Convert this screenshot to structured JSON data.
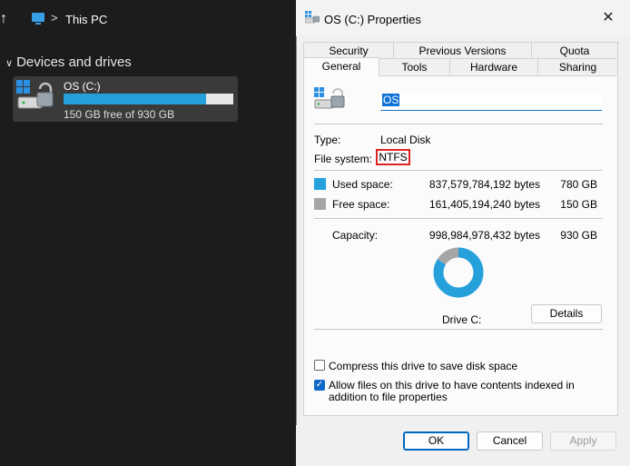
{
  "explorer": {
    "up_arrow": "↑",
    "chevron": ">",
    "location": "This PC",
    "section_caret": "∨",
    "section_title": "Devices and drives",
    "drive": {
      "name": "OS (C:)",
      "free_text": "150 GB free of 930 GB",
      "used_fraction": 0.84
    }
  },
  "dialog": {
    "title": "OS (C:) Properties",
    "close": "✕",
    "tabs_top": [
      "Security",
      "Previous Versions",
      "Quota"
    ],
    "tabs_bottom": [
      "General",
      "Tools",
      "Hardware",
      "Sharing"
    ],
    "active_tab": "General",
    "volume_name": "OS",
    "type_label": "Type:",
    "type_value": "Local Disk",
    "fs_label": "File system:",
    "fs_value": "NTFS",
    "used_label": "Used space:",
    "used_bytes": "837,579,784,192 bytes",
    "used_size": "780 GB",
    "free_label": "Free space:",
    "free_bytes": "161,405,194,240 bytes",
    "free_size": "150 GB",
    "capacity_label": "Capacity:",
    "capacity_bytes": "998,984,978,432 bytes",
    "capacity_size": "930 GB",
    "drive_label": "Drive C:",
    "details_button": "Details",
    "compress_label": "Compress this drive to save disk space",
    "compress_checked": false,
    "index_label": "Allow files on this drive to have contents indexed in addition to file properties",
    "index_checked": true,
    "ok_button": "OK",
    "cancel_button": "Cancel",
    "apply_button": "Apply",
    "colors": {
      "used": "#26a0da",
      "free": "#a6a6a6",
      "highlight": "#e02424"
    }
  }
}
